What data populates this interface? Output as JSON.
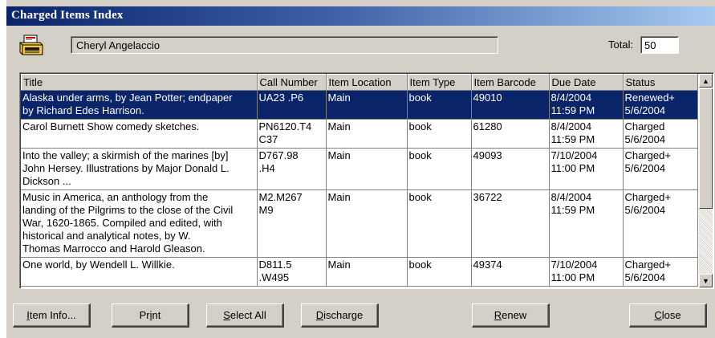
{
  "window": {
    "title": "Charged Items Index"
  },
  "icons": {
    "patron_icon": "printer-icon",
    "scroll_up": "arrow-up-icon",
    "scroll_down": "arrow-down-icon"
  },
  "patron": {
    "name": "Cheryl Angelaccio"
  },
  "total": {
    "label": "Total:",
    "value": "50"
  },
  "columns": [
    "Title",
    "Call Number",
    "Item Location",
    "Item Type",
    "Item Barcode",
    "Due Date",
    "Status"
  ],
  "rows": [
    {
      "title": [
        "Alaska under arms, by Jean Potter; endpaper",
        "by Richard Edes Harrison."
      ],
      "call": [
        "UA23 .P6"
      ],
      "location": "Main",
      "type": "book",
      "barcode": "49010",
      "due": [
        "8/4/2004",
        "11:59 PM"
      ],
      "status": [
        "Renewed+",
        "5/6/2004"
      ],
      "selected": true
    },
    {
      "title": [
        "Carol Burnett Show comedy sketches."
      ],
      "call": [
        "PN6120.T4",
        "C37"
      ],
      "location": "Main",
      "type": "book",
      "barcode": "61280",
      "due": [
        "8/4/2004",
        "11:59 PM"
      ],
      "status": [
        "Charged",
        "5/6/2004"
      ],
      "selected": false
    },
    {
      "title": [
        "Into the valley; a skirmish of the marines [by]",
        "John Hersey. Illustrations by Major Donald L.",
        "Dickson ..."
      ],
      "call": [
        "D767.98",
        ".H4"
      ],
      "location": "Main",
      "type": "book",
      "barcode": "49093",
      "due": [
        "7/10/2004",
        "11:00 PM"
      ],
      "status": [
        "Charged+",
        "5/6/2004"
      ],
      "selected": false
    },
    {
      "title": [
        "Music in America, an anthology from the",
        "landing of the Pilgrims to the close of the Civil",
        "War, 1620-1865. Compiled and edited, with",
        "historical and analytical notes, by W.",
        "Thomas Marrocco and Harold Gleason."
      ],
      "call": [
        "M2.M267",
        "M9"
      ],
      "location": "Main",
      "type": "book",
      "barcode": "36722",
      "due": [
        "8/4/2004",
        "11:59 PM"
      ],
      "status": [
        "Charged+",
        "5/6/2004"
      ],
      "selected": false
    },
    {
      "title": [
        "One world, by Wendell L. Willkie."
      ],
      "call": [
        "D811.5",
        ".W495"
      ],
      "location": "Main",
      "type": "book",
      "barcode": "49374",
      "due": [
        "7/10/2004",
        "11:00 PM"
      ],
      "status": [
        "Charged+",
        "5/6/2004"
      ],
      "selected": false
    }
  ],
  "buttons": [
    {
      "name": "item-info-button",
      "acc": "I",
      "rest": "tem Info..."
    },
    {
      "name": "print-button",
      "pre": "Pr",
      "acc": "i",
      "rest": "nt"
    },
    {
      "name": "select-all-button",
      "acc": "S",
      "rest": "elect All"
    },
    {
      "name": "discharge-button",
      "acc": "D",
      "rest": "ischarge"
    },
    {
      "name": "renew-button",
      "acc": "R",
      "rest": "enew"
    },
    {
      "name": "close-button",
      "acc": "C",
      "rest": "lose"
    }
  ]
}
